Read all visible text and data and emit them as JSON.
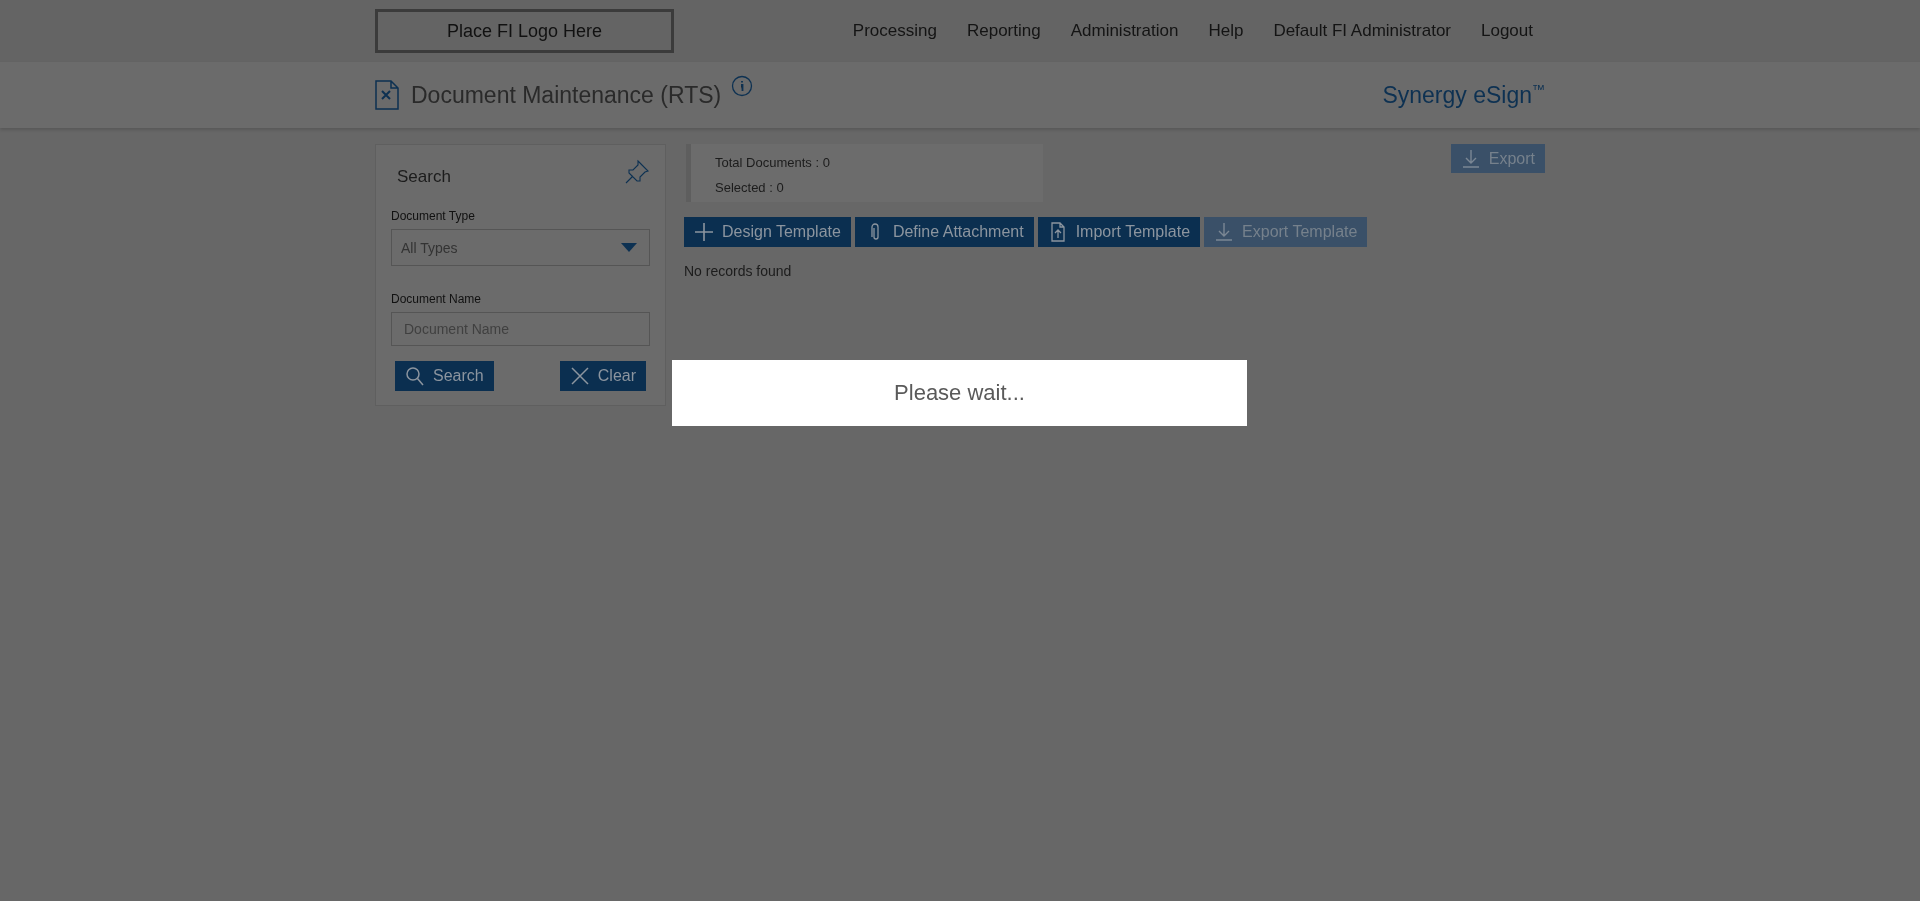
{
  "logo": {
    "text": "Place FI Logo Here"
  },
  "nav": [
    "Processing",
    "Reporting",
    "Administration",
    "Help",
    "Default FI Administrator",
    "Logout"
  ],
  "page": {
    "title": "Document Maintenance (RTS)",
    "brand": "Synergy eSign",
    "brand_mark": "™"
  },
  "search_panel": {
    "title": "Search",
    "fields": [
      {
        "kind": "select",
        "label": "Document Type",
        "value": "All Types"
      },
      {
        "kind": "text",
        "label": "Document Name",
        "placeholder": "Document Name"
      }
    ],
    "buttons": [
      {
        "kind": "search",
        "label": "Search"
      },
      {
        "kind": "clear",
        "label": "Clear"
      }
    ]
  },
  "summary": {
    "total_label": "Total Documents :",
    "total": "0",
    "selected_label": "Selected :",
    "selected": "0"
  },
  "export_button": {
    "label": "Export",
    "disabled": true
  },
  "toolbar": [
    {
      "kind": "plus",
      "label": "Design Template",
      "disabled": false
    },
    {
      "kind": "clip",
      "label": "Define Attachment",
      "disabled": false
    },
    {
      "kind": "import",
      "label": "Import Template",
      "disabled": false
    },
    {
      "kind": "download",
      "label": "Export Template",
      "disabled": true
    }
  ],
  "message": "No records found",
  "wait_dialog": {
    "text": "Please wait..."
  }
}
